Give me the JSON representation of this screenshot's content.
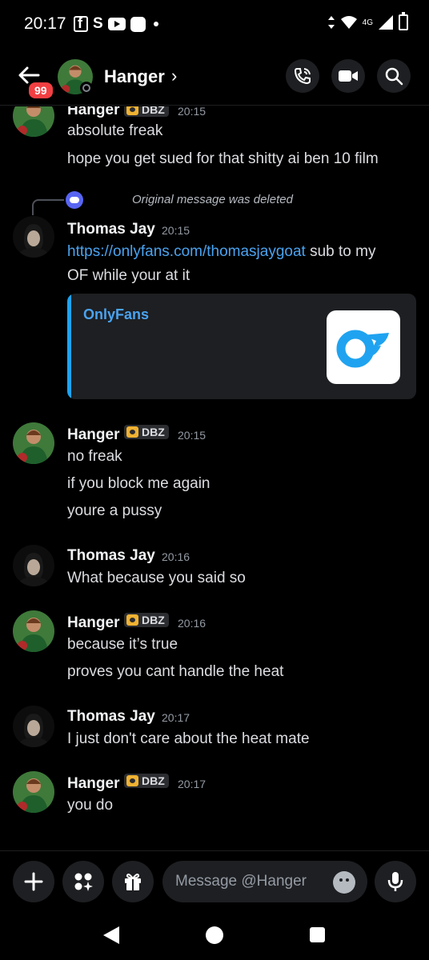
{
  "status_bar": {
    "time": "20:17",
    "network": "4G"
  },
  "header": {
    "unread_badge": "99",
    "title": "Hanger",
    "chevron": "›",
    "icons": [
      "back-arrow-icon",
      "phone-call-icon",
      "video-camera-icon",
      "search-icon"
    ]
  },
  "messages": [
    {
      "author": "Hanger",
      "tag": "DBZ",
      "time": "20:15",
      "lines": [
        "absolute freak",
        "hope you get sued for that shitty ai ben 10 film"
      ]
    },
    {
      "reply_ref": "Original message was deleted",
      "author": "Thomas Jay",
      "time": "20:15",
      "link": "https://onlyfans.com/thomasjaygoat",
      "after_link": " sub to my",
      "line2": "OF while your at it",
      "embed": {
        "title": "OnlyFans",
        "accent": "#1fa3f0"
      }
    },
    {
      "author": "Hanger",
      "tag": "DBZ",
      "time": "20:15",
      "lines": [
        "no freak",
        "if you block me again",
        "youre a pussy"
      ]
    },
    {
      "author": "Thomas Jay",
      "time": "20:16",
      "lines": [
        "What because you said so"
      ]
    },
    {
      "author": "Hanger",
      "tag": "DBZ",
      "time": "20:16",
      "lines": [
        "because it’s true",
        "proves you cant handle the heat"
      ]
    },
    {
      "author": "Thomas Jay",
      "time": "20:17",
      "lines": [
        "I just don't care about the heat mate"
      ]
    },
    {
      "author": "Hanger",
      "tag": "DBZ",
      "time": "20:17",
      "lines": [
        "you do"
      ]
    }
  ],
  "composer": {
    "placeholder": "Message @Hanger"
  },
  "colors": {
    "background": "#000000",
    "link": "#4aa3f0",
    "badge": "#f23f42",
    "blurple": "#5865f2",
    "tag_gold": "#f0b232"
  }
}
